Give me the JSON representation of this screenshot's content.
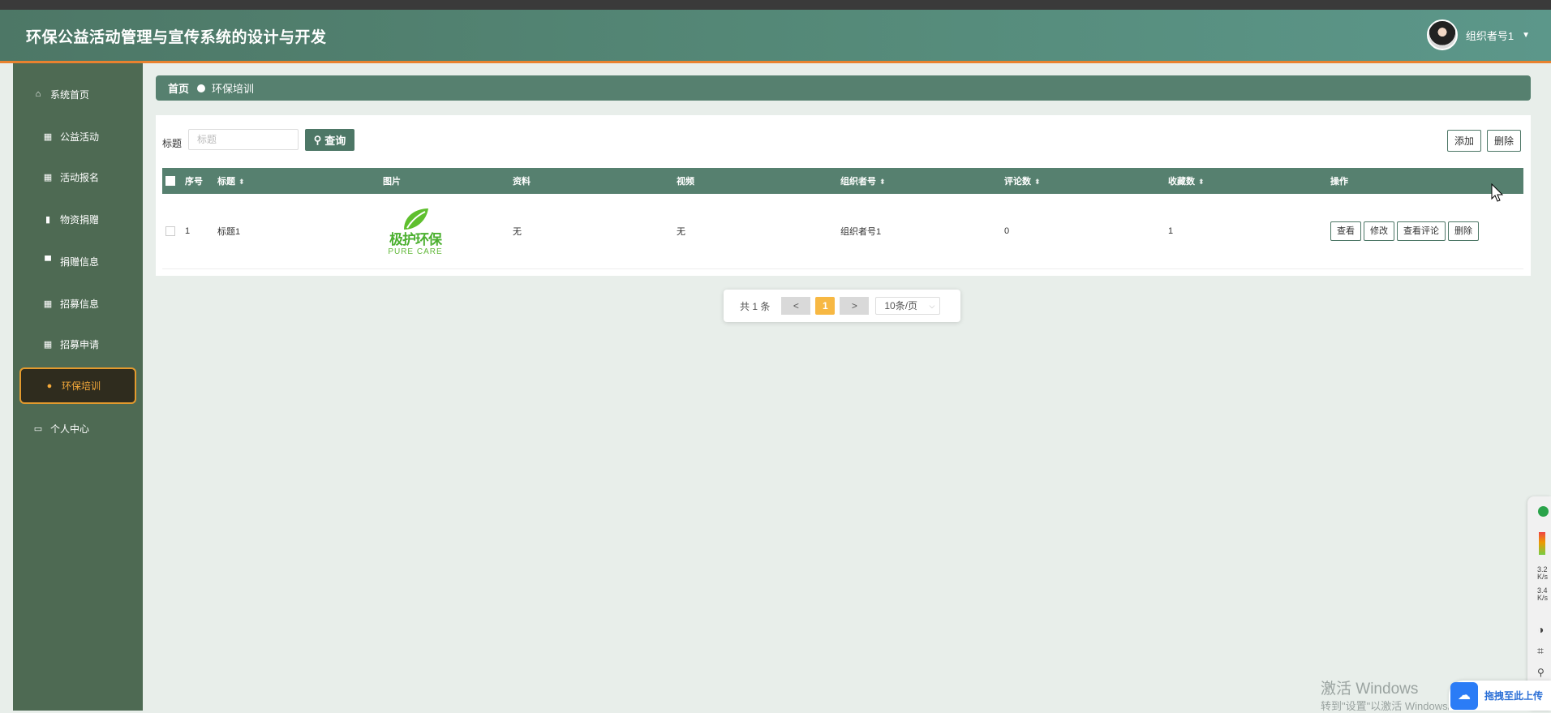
{
  "header": {
    "title": "环保公益活动管理与宣传系统的设计与开发",
    "user_name": "组织者号1"
  },
  "sidebar": {
    "items": [
      {
        "label": "系统首页",
        "icon": "home-icon"
      },
      {
        "label": "公益活动",
        "icon": "grid-icon"
      },
      {
        "label": "活动报名",
        "icon": "grid-icon"
      },
      {
        "label": "物资捐赠",
        "icon": "book-icon"
      },
      {
        "label": "捐赠信息",
        "icon": "monitor-icon"
      },
      {
        "label": "招募信息",
        "icon": "grid-icon"
      },
      {
        "label": "招募申请",
        "icon": "grid-icon"
      },
      {
        "label": "环保培训",
        "icon": "pin-icon",
        "active": true
      },
      {
        "label": "个人中心",
        "icon": "card-icon"
      }
    ]
  },
  "breadcrumb": {
    "home": "首页",
    "current": "环保培训"
  },
  "search": {
    "label": "标题",
    "placeholder": "标题",
    "button": "查询"
  },
  "toolbar": {
    "add": "添加",
    "delete": "删除"
  },
  "table": {
    "headers": [
      "序号",
      "标题",
      "图片",
      "资料",
      "视频",
      "组织者号",
      "评论数",
      "收藏数",
      "操作"
    ],
    "rows": [
      {
        "index": "1",
        "title": "标题1",
        "image": {
          "logo_cn": "极护环保",
          "logo_en": "PURE CARE"
        },
        "material": "无",
        "video": "无",
        "organizer": "组织者号1",
        "comments": "0",
        "favorites": "1",
        "actions": [
          "查看",
          "修改",
          "查看评论",
          "删除"
        ]
      }
    ]
  },
  "pagination": {
    "total": "共 1 条",
    "prev": "<",
    "current": "1",
    "next": ">",
    "page_size": "10条/页"
  },
  "tray": {
    "rate1": "3.2",
    "rate1_unit": "K/s",
    "rate2": "3.4",
    "rate2_unit": "K/s"
  },
  "windows_watermark": {
    "line1": "激活 Windows",
    "line2": "转到\"设置\"以激活 Windows。"
  },
  "upload_widget": {
    "label": "拖拽至此上传"
  },
  "colors": {
    "header": "#558a79",
    "sidebar": "#4e6a53",
    "accent": "#e9822f",
    "active_text": "#f4a93a",
    "page_num": "#f7b843"
  }
}
